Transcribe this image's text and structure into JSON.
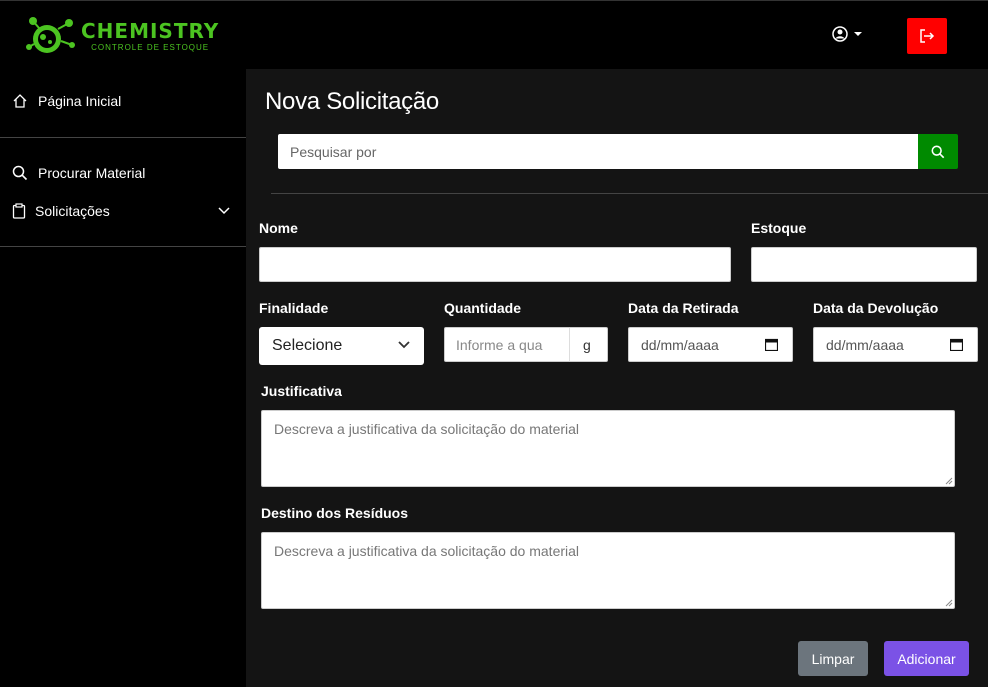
{
  "brand": {
    "title": "CHEMISTRY",
    "subtitle": "CONTROLE DE ESTOQUE",
    "color": "#4cc421"
  },
  "header": {
    "user_icon": "user-circle-icon",
    "logout_icon": "logout-icon",
    "logout_color": "#ff0000"
  },
  "sidebar": {
    "items": [
      {
        "label": "Página Inicial",
        "icon": "home-icon"
      },
      {
        "label": "Procurar Material",
        "icon": "search-icon"
      },
      {
        "label": "Solicitações",
        "icon": "clipboard-icon"
      }
    ]
  },
  "main": {
    "title": "Nova Solicitação",
    "search": {
      "placeholder": "Pesquisar por",
      "button_color": "#008a00"
    },
    "form": {
      "nome_label": "Nome",
      "nome_value": "",
      "estoque_label": "Estoque",
      "estoque_value": "",
      "finalidade_label": "Finalidade",
      "finalidade_selected": "Selecione",
      "quantidade_label": "Quantidade",
      "quantidade_placeholder": "Informe a qua",
      "quantidade_unit": "g",
      "retirada_label": "Data da Retirada",
      "retirada_placeholder": "dd/mm/aaaa",
      "devolucao_label": "Data da Devolução",
      "devolucao_placeholder": "dd/mm/aaaa",
      "justificativa_label": "Justificativa",
      "justificativa_placeholder": "Descreva a justificativa da solicitação do material",
      "destino_label": "Destino dos Resíduos",
      "destino_placeholder": "Descreva a justificativa da solicitação do material"
    },
    "buttons": {
      "clear": "Limpar",
      "add": "Adicionar",
      "clear_color": "#6c757d",
      "add_color": "#7b52e6"
    }
  }
}
